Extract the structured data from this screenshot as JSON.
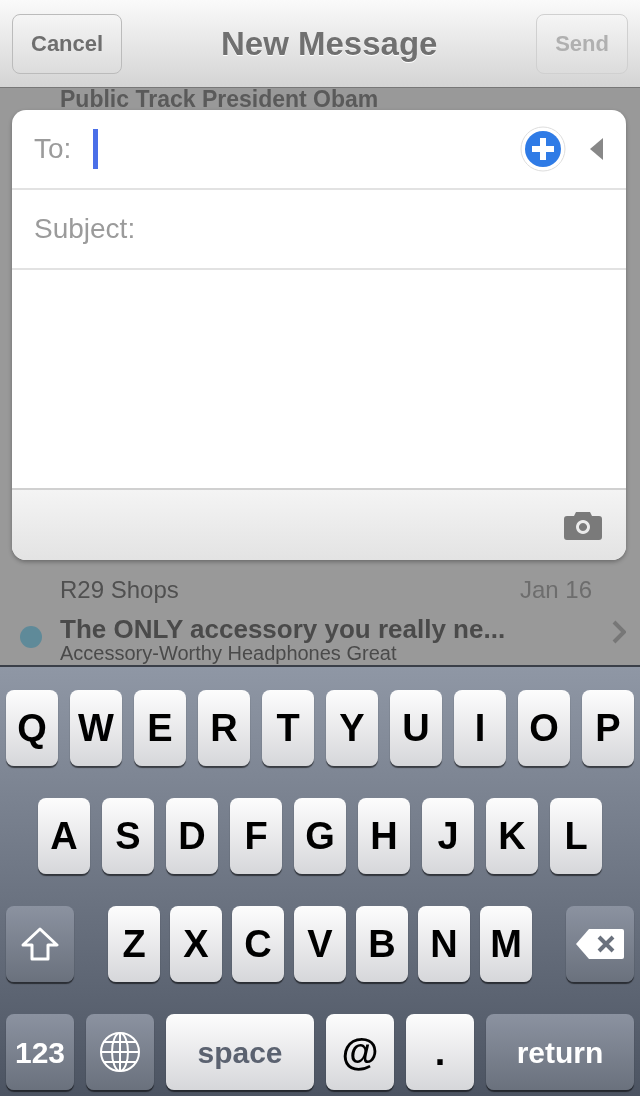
{
  "header": {
    "cancel": "Cancel",
    "title": "New Message",
    "send": {
      "label": "Send",
      "disabled": true
    }
  },
  "background_list": {
    "partial_subject": "Public Track President Obam",
    "message": {
      "sender": "R29 Shops",
      "date": "Jan 16",
      "subject": "The ONLY accessory you really ne...",
      "preview": "Accessory-Worthy Headphones Great",
      "unread": true
    }
  },
  "compose": {
    "to_label": "To:",
    "subject_label": "Subject:"
  },
  "keyboard": {
    "rows": [
      {
        "keys": [
          {
            "kind": "letter",
            "label": "Q"
          },
          {
            "kind": "letter",
            "label": "W"
          },
          {
            "kind": "letter",
            "label": "E"
          },
          {
            "kind": "letter",
            "label": "R"
          },
          {
            "kind": "letter",
            "label": "T"
          },
          {
            "kind": "letter",
            "label": "Y"
          },
          {
            "kind": "letter",
            "label": "U"
          },
          {
            "kind": "letter",
            "label": "I"
          },
          {
            "kind": "letter",
            "label": "O"
          },
          {
            "kind": "letter",
            "label": "P"
          }
        ]
      },
      {
        "keys": [
          {
            "kind": "letter",
            "label": "A"
          },
          {
            "kind": "letter",
            "label": "S"
          },
          {
            "kind": "letter",
            "label": "D"
          },
          {
            "kind": "letter",
            "label": "F"
          },
          {
            "kind": "letter",
            "label": "G"
          },
          {
            "kind": "letter",
            "label": "H"
          },
          {
            "kind": "letter",
            "label": "J"
          },
          {
            "kind": "letter",
            "label": "K"
          },
          {
            "kind": "letter",
            "label": "L"
          }
        ]
      },
      {
        "keys": [
          {
            "kind": "shift"
          },
          {
            "kind": "letter",
            "label": "Z"
          },
          {
            "kind": "letter",
            "label": "X"
          },
          {
            "kind": "letter",
            "label": "C"
          },
          {
            "kind": "letter",
            "label": "V"
          },
          {
            "kind": "letter",
            "label": "B"
          },
          {
            "kind": "letter",
            "label": "N"
          },
          {
            "kind": "letter",
            "label": "M"
          },
          {
            "kind": "delete"
          }
        ]
      },
      {
        "keys": [
          {
            "kind": "function",
            "label": "123"
          },
          {
            "kind": "globe"
          },
          {
            "kind": "space",
            "label": "space"
          },
          {
            "kind": "letter",
            "label": "@"
          },
          {
            "kind": "letter",
            "label": "."
          },
          {
            "kind": "function",
            "label": "return"
          }
        ]
      }
    ]
  }
}
